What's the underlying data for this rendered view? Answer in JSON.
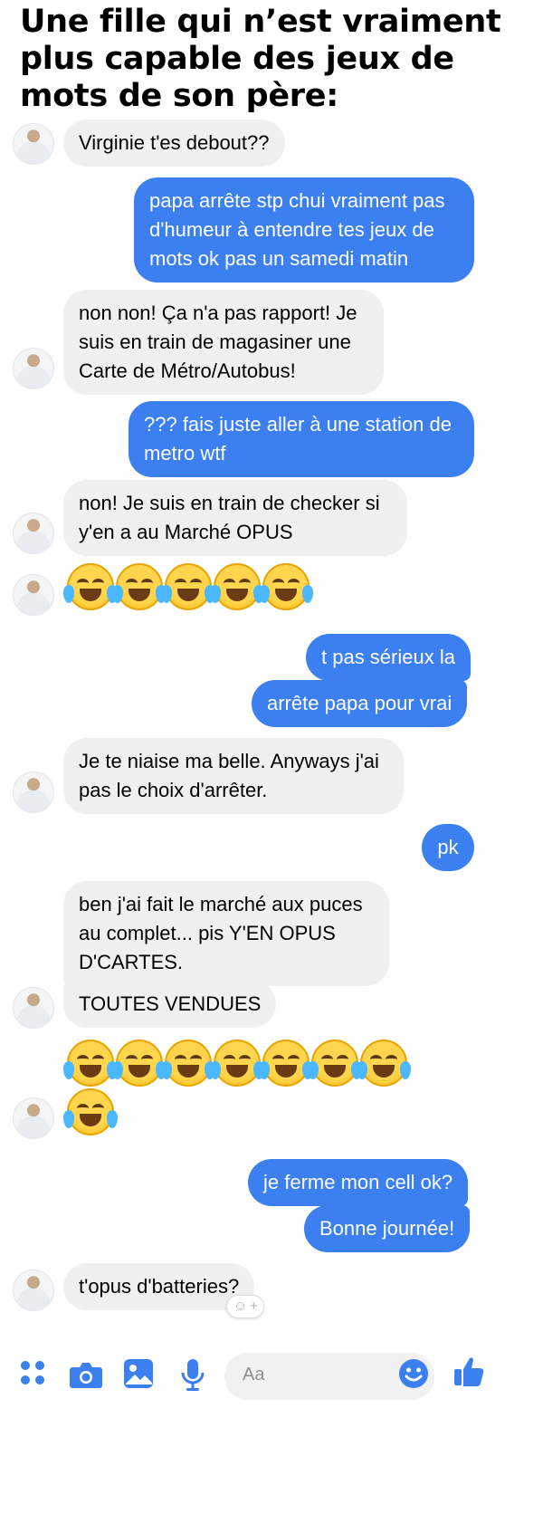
{
  "title": "Une fille qui n’est vraiment plus capable des jeux de mots de son père:",
  "messages": {
    "m1": "Virginie t'es debout??",
    "m2_l1": "papa arrête stp chui vraiment pas",
    "m2_l2": "d'humeur à entendre tes jeux de",
    "m2_l3": "mots ok pas un samedi matin",
    "m3_l1": "non non! Ça n'a pas rapport! Je",
    "m3_l2": "suis en train de magasiner une",
    "m3_l3": "Carte de Métro/Autobus!",
    "m4_l1": "??? fais juste aller à une station de",
    "m4_l2": "metro wtf",
    "m5_l1": "non! Je suis en train de checker si",
    "m5_l2": "y'en a au Marché OPUS",
    "m6": "t pas sérieux la",
    "m7": "arrête papa pour vrai",
    "m8_l1": "Je te niaise ma belle. Anyways j'ai",
    "m8_l2": "pas le choix d'arrêter.",
    "m9": "pk",
    "m10_l1": "ben j'ai fait le marché aux puces",
    "m10_l2": "au complet... pis Y'EN OPUS",
    "m10_l3": "D'CARTES.",
    "m11": "TOUTES VENDUES",
    "m12": "je ferme mon cell ok?",
    "m13": "Bonne journée!",
    "m14": "t'opus d'batteries?"
  },
  "emoji_rows": {
    "row1_count": 5,
    "row2_count": 8
  },
  "composer": {
    "placeholder": "Aa",
    "icons": [
      "apps-icon",
      "camera-icon",
      "gallery-icon",
      "microphone-icon",
      "emoji-icon",
      "thumbs-up-icon"
    ]
  },
  "colors": {
    "outgoing_bubble": "#3b7ff0",
    "incoming_bubble": "#f0f0f0",
    "accent": "#3b7ff0"
  }
}
